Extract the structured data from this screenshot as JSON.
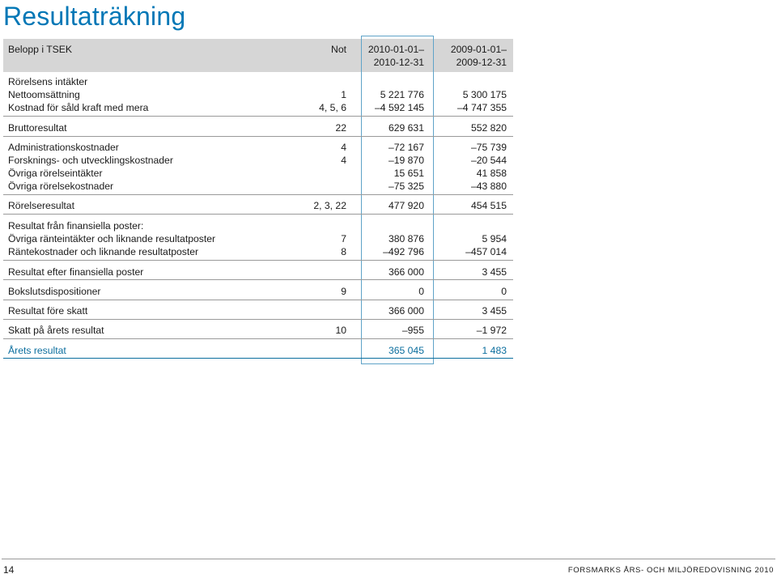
{
  "title": "Resultaträkning",
  "header": {
    "label": "Belopp i TSEK",
    "not": "Not",
    "col1_line1": "2010-01-01–",
    "col1_line2": "2010-12-31",
    "col2_line1": "2009-01-01–",
    "col2_line2": "2009-12-31"
  },
  "rows": [
    {
      "label": "Rörelsens intäkter",
      "not": "",
      "v1": "",
      "v2": ""
    },
    {
      "label": "Nettoomsättning",
      "not": "1",
      "v1": "5 221 776",
      "v2": "5 300 175"
    },
    {
      "label": "Kostnad för såld kraft med mera",
      "not": "4, 5, 6",
      "v1": "–4 592 145",
      "v2": "–4 747 355"
    },
    {
      "label": "Bruttoresultat",
      "not": "22",
      "v1": "629 631",
      "v2": "552 820"
    },
    {
      "label": "Administrationskostnader",
      "not": "4",
      "v1": "–72 167",
      "v2": "–75 739"
    },
    {
      "label": "Forsknings- och utvecklingskostnader",
      "not": "4",
      "v1": "–19 870",
      "v2": "–20 544"
    },
    {
      "label": "Övriga rörelseintäkter",
      "not": "",
      "v1": "15 651",
      "v2": "41 858"
    },
    {
      "label": "Övriga rörelsekostnader",
      "not": "",
      "v1": "–75 325",
      "v2": "–43 880"
    },
    {
      "label": "Rörelseresultat",
      "not": "2, 3, 22",
      "v1": "477 920",
      "v2": "454 515"
    },
    {
      "label": "Resultat från finansiella poster:",
      "not": "",
      "v1": "",
      "v2": ""
    },
    {
      "label": "Övriga ränteintäkter och liknande resultatposter",
      "not": "7",
      "v1": "380 876",
      "v2": "5 954"
    },
    {
      "label": "Räntekostnader och liknande resultatposter",
      "not": "8",
      "v1": "–492 796",
      "v2": "–457 014"
    },
    {
      "label": "Resultat efter finansiella poster",
      "not": "",
      "v1": "366 000",
      "v2": "3 455"
    },
    {
      "label": "Bokslutsdispositioner",
      "not": "9",
      "v1": "0",
      "v2": "0"
    },
    {
      "label": "Resultat före skatt",
      "not": "",
      "v1": "366 000",
      "v2": "3 455"
    },
    {
      "label": "Skatt på årets resultat",
      "not": "10",
      "v1": "–955",
      "v2": "–1 972"
    },
    {
      "label": "Årets resultat",
      "not": "",
      "v1": "365 045",
      "v2": "1 483"
    }
  ],
  "footer": {
    "page_number": "14",
    "publication": "FORSMARKS ÅRS- OCH MILJÖREDOVISNING 2010"
  },
  "colors": {
    "accent": "#0077b6",
    "header_bg": "#d6d6d6",
    "highlight_border": "#5fa3c8"
  }
}
